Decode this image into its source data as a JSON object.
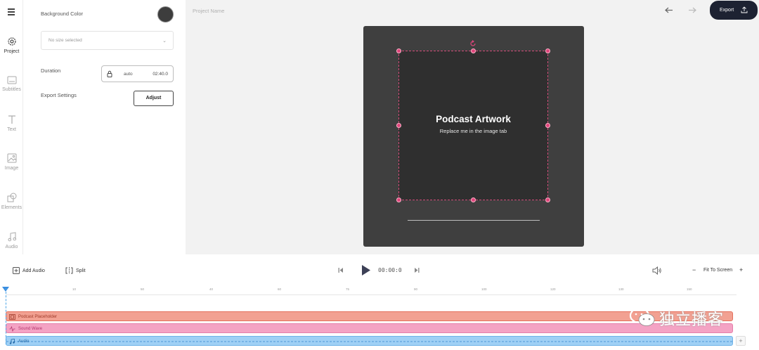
{
  "sidebar": {
    "items": [
      {
        "label": "Project",
        "icon": "gear-icon"
      },
      {
        "label": "Subtitles",
        "icon": "subtitles-icon"
      },
      {
        "label": "Text",
        "icon": "text-icon"
      },
      {
        "label": "Image",
        "icon": "image-icon"
      },
      {
        "label": "Elements",
        "icon": "elements-icon"
      },
      {
        "label": "Audio",
        "icon": "music-note-icon"
      }
    ]
  },
  "panel": {
    "background_color_label": "Background Color",
    "background_color_value": "#3d3d3d",
    "size_placeholder": "No size selected",
    "duration_label": "Duration",
    "duration_mode": "auto",
    "duration_value": "02:40.0",
    "export_settings_label": "Export Settings",
    "adjust_label": "Adjust"
  },
  "header": {
    "project_name_placeholder": "Project Name",
    "export_label": "Export"
  },
  "canvas": {
    "title": "Podcast Artwork",
    "subtitle": "Replace me in the image tab",
    "accent": "#e0457b"
  },
  "toolbar": {
    "add_audio_label": "Add Audio",
    "split_label": "Split",
    "timecode": "00:00:0",
    "fit_label": "Fit To Screen",
    "zoom_out": "−",
    "zoom_in": "+"
  },
  "timeline": {
    "ticks": [
      "10",
      "50",
      "40",
      "60",
      "75",
      "90",
      "100",
      "120",
      "130",
      "150"
    ],
    "tracks": [
      {
        "label": "Podcast Placeholder",
        "icon": "image-icon"
      },
      {
        "label": "Sound Wave",
        "icon": "wave-icon"
      },
      {
        "label": "Audio",
        "icon": "music-note-icon"
      }
    ],
    "add_track_label": "+"
  },
  "watermark": {
    "text": "独立播客"
  }
}
